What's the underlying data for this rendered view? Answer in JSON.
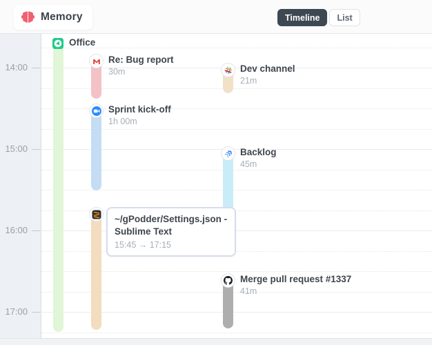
{
  "header": {
    "app_name": "Memory",
    "logo_icon": "brain-icon",
    "view_tabs": [
      {
        "label": "Timeline",
        "active": true
      },
      {
        "label": "List",
        "active": false
      }
    ]
  },
  "time_axis": {
    "labels": [
      "14:00",
      "15:00",
      "16:00",
      "17:00"
    ]
  },
  "events": [
    {
      "title": "Office",
      "subtitle": "",
      "icon": "location-pin-icon",
      "color": "#e0f6d7"
    },
    {
      "title": "Re: Bug report",
      "subtitle": "30m",
      "icon": "gmail-icon",
      "color": "#f3c2c6"
    },
    {
      "title": "Dev channel",
      "subtitle": "21m",
      "icon": "slack-icon",
      "color": "#f2e1c7"
    },
    {
      "title": "Sprint kick-off",
      "subtitle": "1h 00m",
      "icon": "zoom-icon",
      "color": "#c4ddf4"
    },
    {
      "title": "Backlog",
      "subtitle": "45m",
      "icon": "jira-icon",
      "color": "#c9edf8"
    },
    {
      "title": "~/gPodder/Settings.json - Sublime Text",
      "subtitle": "15:45 → 17:15",
      "icon": "sublime-text-icon",
      "color": "#f4dcbe"
    },
    {
      "title": "Merge pull request #1337",
      "subtitle": "41m",
      "icon": "github-icon",
      "color": "#aeaeae"
    }
  ],
  "colors": {
    "brand_pink": "#f0616f",
    "toggle_active_bg": "#3d4852",
    "office_green_icon": "#23c98e",
    "zoom_blue": "#2d8cff",
    "github_black": "#1b1f23",
    "sublime_orange": "#ff9700",
    "gmail_red": "#e23c32",
    "title_text": "#3f454d",
    "muted_text": "#a8aeb6"
  }
}
